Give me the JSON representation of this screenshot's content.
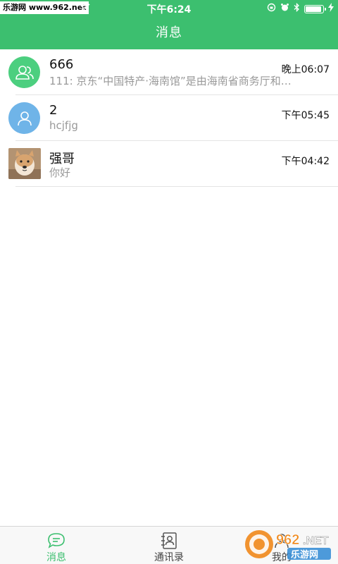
{
  "status_bar": {
    "watermark": "乐游网 www.962.net",
    "time": "下午6:24",
    "battery_level": 0.9
  },
  "header": {
    "title": "消息"
  },
  "conversations": [
    {
      "name": "666",
      "preview": "111: 京东“中国特产·海南馆”是由海南省商务厅和…",
      "time": "晚上06:07",
      "avatar": "group-icon"
    },
    {
      "name": "2",
      "preview": "hcjfjg",
      "time": "下午05:45",
      "avatar": "person-icon"
    },
    {
      "name": "强哥",
      "preview": "你好",
      "time": "下午04:42",
      "avatar": "dog-photo"
    }
  ],
  "tabbar": {
    "tabs": [
      {
        "label": "消息",
        "icon": "chat-bubble-icon",
        "active": true
      },
      {
        "label": "通讯录",
        "icon": "contacts-book-icon",
        "active": false
      },
      {
        "label": "我的",
        "icon": "profile-icon",
        "active": false
      }
    ]
  },
  "colors": {
    "brand": "#3cbf6f",
    "group_avatar": "#4ccf7f",
    "person_avatar": "#6fb4e8"
  },
  "watermark_logo": "962.NET 乐游网"
}
